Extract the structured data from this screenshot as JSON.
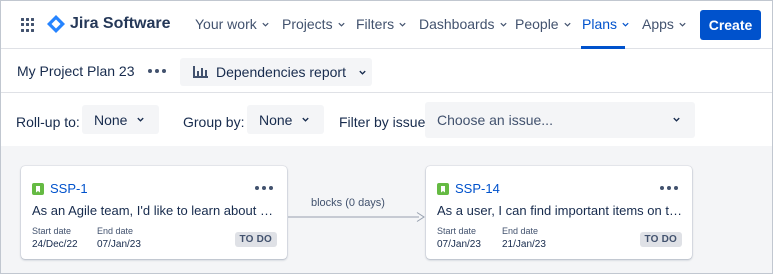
{
  "nav": {
    "product": "Jira Software",
    "items": [
      {
        "label": "Your work",
        "active": false
      },
      {
        "label": "Projects",
        "active": false
      },
      {
        "label": "Filters",
        "active": false
      },
      {
        "label": "Dashboards",
        "active": false
      },
      {
        "label": "People",
        "active": false
      },
      {
        "label": "Plans",
        "active": true
      },
      {
        "label": "Apps",
        "active": false
      }
    ],
    "create_label": "Create"
  },
  "plan": {
    "title": "My Project Plan 23",
    "report_label": "Dependencies report"
  },
  "filters": {
    "rollup_label": "Roll-up to:",
    "rollup_value": "None",
    "group_label": "Group by:",
    "group_value": "None",
    "issue_label": "Filter by issue:",
    "issue_placeholder": "Choose an issue..."
  },
  "dependency": {
    "label": "blocks (0 days)"
  },
  "cards": [
    {
      "key": "SSP-1",
      "summary": "As an Agile team, I'd like to learn about Sc...",
      "start_label": "Start date",
      "start_value": "24/Dec/22",
      "end_label": "End date",
      "end_value": "07/Jan/23",
      "status": "TO DO"
    },
    {
      "key": "SSP-14",
      "summary": "As a user, I can find important items on th...",
      "start_label": "Start date",
      "start_value": "07/Jan/23",
      "end_label": "End date",
      "end_value": "21/Jan/23",
      "status": "TO DO"
    }
  ],
  "colors": {
    "brand": "#0052cc",
    "story": "#65ba43",
    "text": "#172b4d",
    "subtle": "#42526e",
    "canvas": "#f4f5f7"
  }
}
